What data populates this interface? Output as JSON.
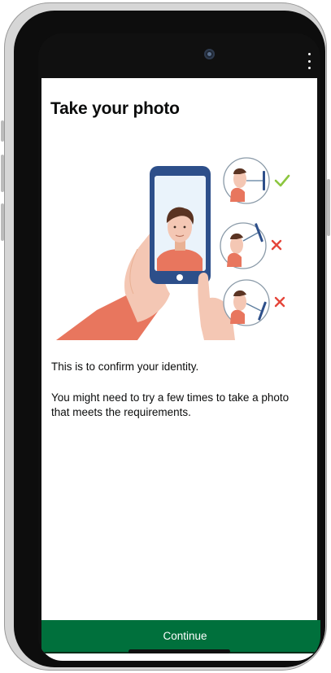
{
  "page": {
    "title": "Take your photo",
    "paragraphs": [
      "This is to confirm your identity.",
      "You might need to try a few times to take a photo that meets the requirements."
    ]
  },
  "illustration": {
    "icons": [
      "phone-selfie-illustration",
      "correct-head-position-icon",
      "head-tilted-up-icon",
      "head-tilted-down-icon",
      "check-icon",
      "cross-icon"
    ]
  },
  "actions": {
    "continue_label": "Continue"
  },
  "colors": {
    "primary_button": "#00703c",
    "text": "#0b0c0c",
    "check": "#8cc63f",
    "cross": "#e5453a",
    "phone_blue": "#2d4f8a"
  }
}
